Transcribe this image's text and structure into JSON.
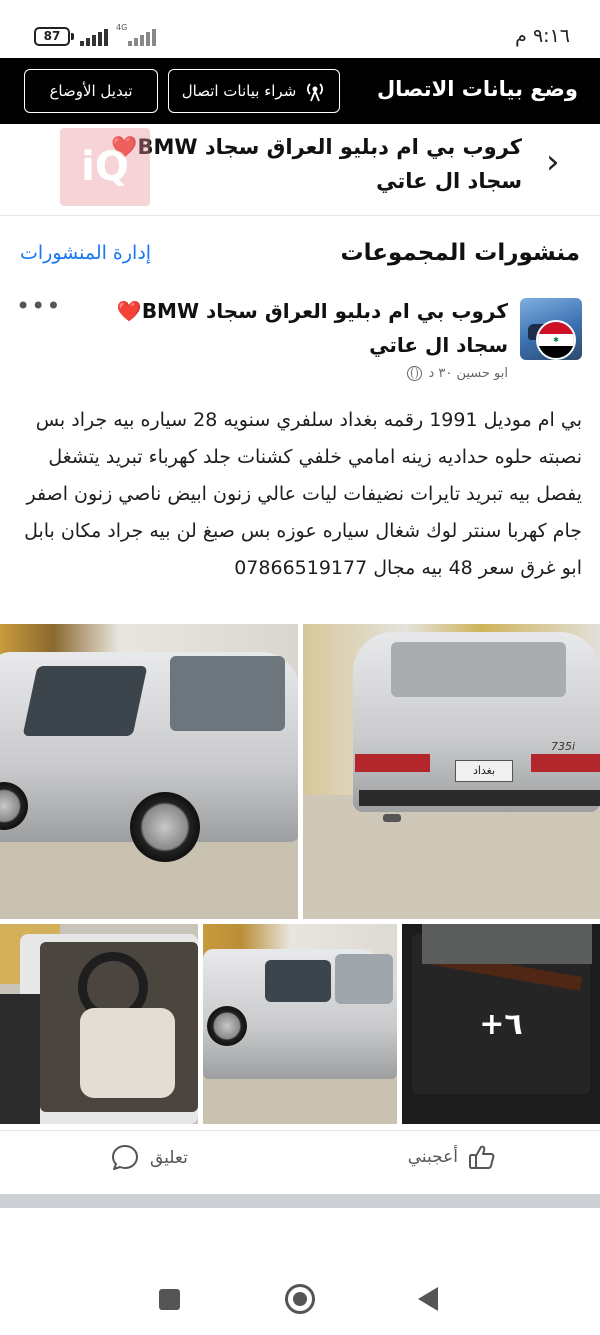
{
  "status_bar": {
    "battery": "87",
    "network": "4G",
    "time": "٩:١٦ م"
  },
  "banner": {
    "title": "وضع بيانات الاتصال",
    "buy_button": "شراء بيانات اتصال",
    "switch_button": "تبديل الأوضاع"
  },
  "group": {
    "title": "كروب بي ام دبليو العراق سجاد BMW❤️ سجاد ال عاتي",
    "watermark": "iQ"
  },
  "section": {
    "title": "منشورات المجموعات",
    "manage": "إدارة المنشورات"
  },
  "post": {
    "author": "كروب بي ام دبليو العراق سجاد BMW❤️سجاد ال عاتي",
    "meta": "ابو حسين ٣٠ د",
    "body": "بي ام موديل 1991 رقمه بغداد سلفري سنويه 28 سياره بيه جراد بس نصبته حلوه حداديه زينه امامي خلفي كشنات جلد كهرباء تبريد يتشغل يفصل بيه تبريد تايرات نضيفات ليات عالي زنون ابيض ناصي زنون اصفر جام كهربا سنتر لوك شغال سياره عوزه بس صبغ لن بيه جراد مكان بابل ابو غرق سعر 48 بيه مجال 07866519177",
    "more_photos": "+٦",
    "plate_text": "بغداد",
    "badge_text": "735i",
    "like_label": "أعجبني",
    "comment_label": "تعليق"
  },
  "colors": {
    "link": "#1877f2",
    "banner_bg": "#000000"
  }
}
